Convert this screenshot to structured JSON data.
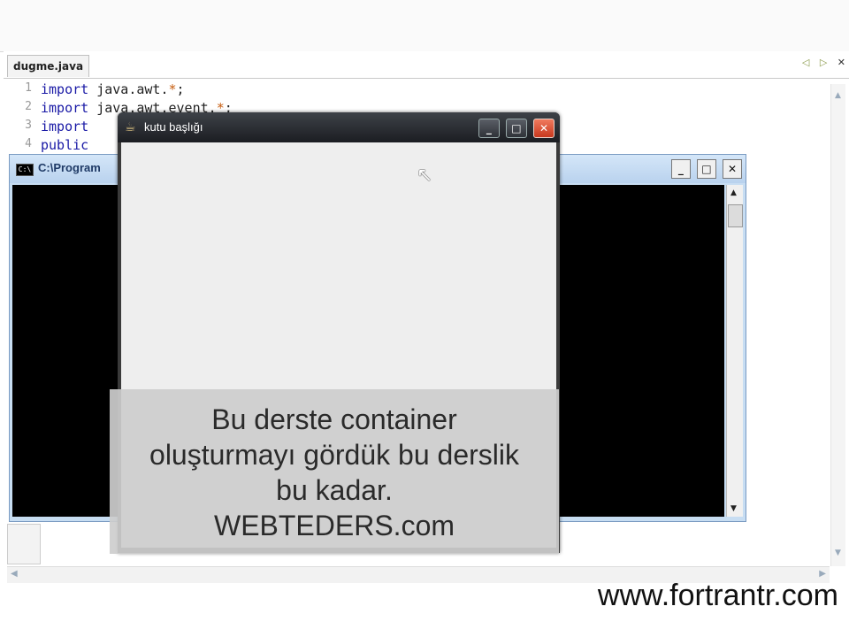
{
  "ide": {
    "tab_label": "dugme.java",
    "tab_nav_prev": "◁",
    "tab_nav_next": "▷",
    "tab_close": "✕",
    "line_numbers": [
      "1",
      "2",
      "3",
      "4"
    ],
    "code_lines": [
      {
        "kw": "import",
        "rest": " java.awt.",
        "str": "*",
        "end": ";"
      },
      {
        "kw": "import",
        "rest": " java.awt.event.",
        "str": "*",
        "end": ";"
      },
      {
        "kw": "import",
        "rest": "",
        "str": "",
        "end": ""
      },
      {
        "kw": "public",
        "rest": "",
        "str": "",
        "end": ""
      }
    ]
  },
  "console": {
    "icon_text": "C:\\",
    "title": "C:\\Program",
    "minimize": "_",
    "maximize": "□",
    "close": "✕"
  },
  "frame": {
    "icon": "☕",
    "title": "kutu başlığı",
    "minimize": "_",
    "maximize": "□",
    "close": "✕",
    "cursor": "↖"
  },
  "subtitle": {
    "lines": [
      "Bu derste container",
      "oluşturmayı gördük bu derslik",
      "bu kadar.",
      "WEBTEDERS.com"
    ]
  },
  "watermark": "www.fortrantr.com"
}
